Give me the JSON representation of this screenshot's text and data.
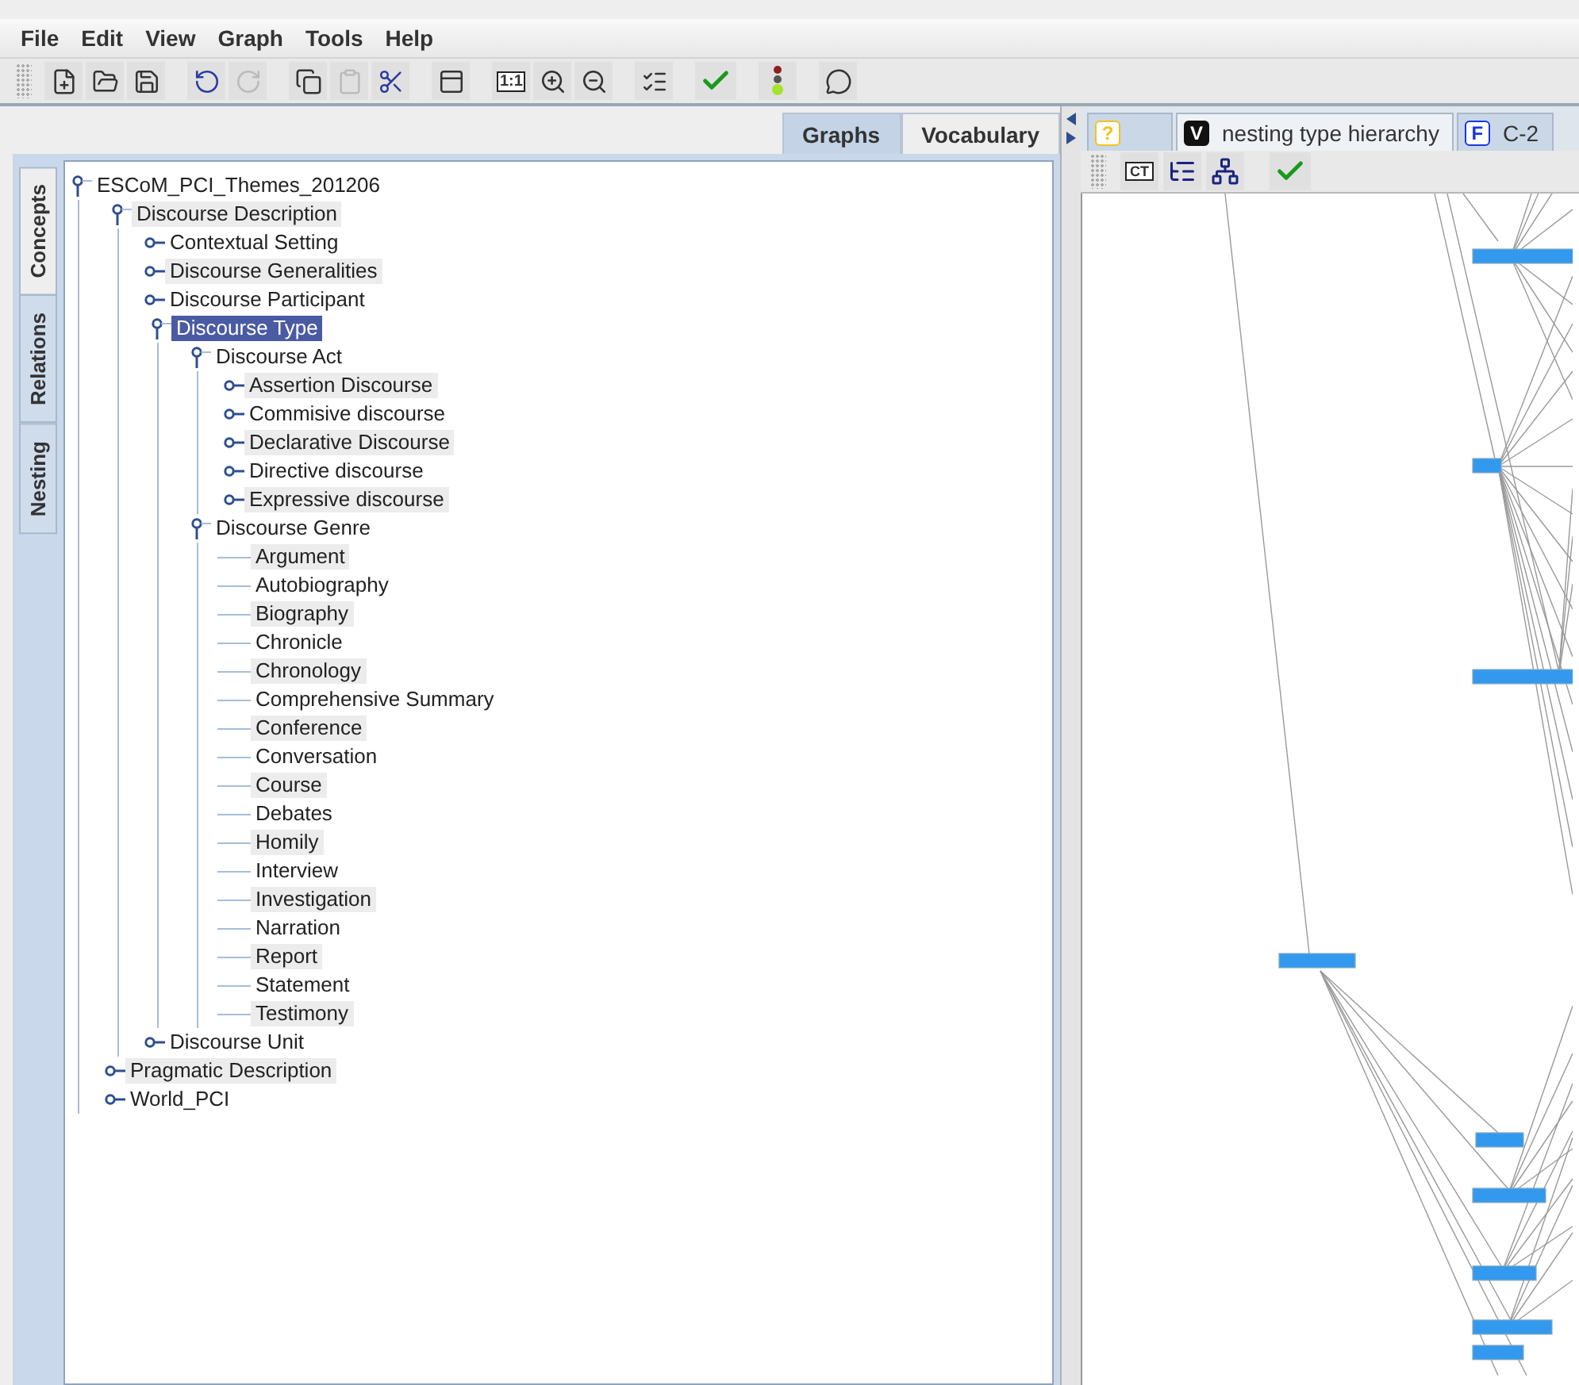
{
  "menu": [
    "File",
    "Edit",
    "View",
    "Graph",
    "Tools",
    "Help"
  ],
  "toolbar": [
    {
      "kind": "new",
      "disabled": false
    },
    {
      "kind": "open",
      "disabled": false
    },
    {
      "kind": "save",
      "disabled": false
    },
    {
      "kind": "sep"
    },
    {
      "kind": "undo",
      "disabled": false
    },
    {
      "kind": "redo",
      "disabled": true
    },
    {
      "kind": "sep"
    },
    {
      "kind": "copy",
      "disabled": false
    },
    {
      "kind": "paste",
      "disabled": true
    },
    {
      "kind": "cut",
      "disabled": false
    },
    {
      "kind": "sep"
    },
    {
      "kind": "layout",
      "disabled": false
    },
    {
      "kind": "sep"
    },
    {
      "kind": "actual",
      "label": "1:1",
      "disabled": false
    },
    {
      "kind": "zoomin",
      "disabled": false
    },
    {
      "kind": "zoomout",
      "disabled": false
    },
    {
      "kind": "sep"
    },
    {
      "kind": "checklist",
      "disabled": false
    },
    {
      "kind": "sep"
    },
    {
      "kind": "check",
      "disabled": false
    },
    {
      "kind": "sep"
    },
    {
      "kind": "light",
      "disabled": false
    },
    {
      "kind": "sep"
    },
    {
      "kind": "comment",
      "disabled": false
    }
  ],
  "top_tabs": [
    {
      "label": "Graphs",
      "selected": false
    },
    {
      "label": "Vocabulary",
      "selected": true
    }
  ],
  "side_tabs": [
    {
      "label": "Concepts",
      "selected": true
    },
    {
      "label": "Relations",
      "selected": false
    },
    {
      "label": "Nesting",
      "selected": false
    }
  ],
  "tree": [
    {
      "label": "ESCoM_PCI_Themes_201206",
      "kind": "branch",
      "expanded": true,
      "highlighted": false,
      "selected": false,
      "children": [
        {
          "label": "Discourse Description",
          "kind": "branch",
          "expanded": true,
          "highlighted": true,
          "selected": false,
          "children": [
            {
              "label": "Contextual Setting",
              "kind": "branch",
              "expanded": false,
              "highlighted": false,
              "selected": false
            },
            {
              "label": "Discourse Generalities",
              "kind": "branch",
              "expanded": false,
              "highlighted": true,
              "selected": false
            },
            {
              "label": "Discourse Participant",
              "kind": "branch",
              "expanded": false,
              "highlighted": false,
              "selected": false
            },
            {
              "label": "Discourse Type",
              "kind": "branch",
              "expanded": true,
              "highlighted": false,
              "selected": true,
              "children": [
                {
                  "label": "Discourse Act",
                  "kind": "branch",
                  "expanded": true,
                  "highlighted": false,
                  "selected": false,
                  "children": [
                    {
                      "label": "Assertion Discourse",
                      "kind": "branch",
                      "expanded": false,
                      "highlighted": true,
                      "selected": false
                    },
                    {
                      "label": "Commisive discourse",
                      "kind": "branch",
                      "expanded": false,
                      "highlighted": false,
                      "selected": false
                    },
                    {
                      "label": "Declarative Discourse",
                      "kind": "branch",
                      "expanded": false,
                      "highlighted": true,
                      "selected": false
                    },
                    {
                      "label": "Directive discourse",
                      "kind": "branch",
                      "expanded": false,
                      "highlighted": false,
                      "selected": false
                    },
                    {
                      "label": "Expressive discourse",
                      "kind": "branch",
                      "expanded": false,
                      "highlighted": true,
                      "selected": false
                    }
                  ]
                },
                {
                  "label": "Discourse Genre",
                  "kind": "branch",
                  "expanded": true,
                  "highlighted": false,
                  "selected": false,
                  "children": [
                    {
                      "label": "Argument",
                      "kind": "leaf",
                      "highlighted": true,
                      "selected": false
                    },
                    {
                      "label": "Autobiography",
                      "kind": "leaf",
                      "highlighted": false,
                      "selected": false
                    },
                    {
                      "label": "Biography",
                      "kind": "leaf",
                      "highlighted": true,
                      "selected": false
                    },
                    {
                      "label": "Chronicle",
                      "kind": "leaf",
                      "highlighted": false,
                      "selected": false
                    },
                    {
                      "label": "Chronology",
                      "kind": "leaf",
                      "highlighted": true,
                      "selected": false
                    },
                    {
                      "label": "Comprehensive Summary",
                      "kind": "leaf",
                      "highlighted": false,
                      "selected": false
                    },
                    {
                      "label": "Conference",
                      "kind": "leaf",
                      "highlighted": true,
                      "selected": false
                    },
                    {
                      "label": "Conversation",
                      "kind": "leaf",
                      "highlighted": false,
                      "selected": false
                    },
                    {
                      "label": "Course",
                      "kind": "leaf",
                      "highlighted": true,
                      "selected": false
                    },
                    {
                      "label": "Debates",
                      "kind": "leaf",
                      "highlighted": false,
                      "selected": false
                    },
                    {
                      "label": "Homily",
                      "kind": "leaf",
                      "highlighted": true,
                      "selected": false
                    },
                    {
                      "label": "Interview",
                      "kind": "leaf",
                      "highlighted": false,
                      "selected": false
                    },
                    {
                      "label": "Investigation",
                      "kind": "leaf",
                      "highlighted": true,
                      "selected": false
                    },
                    {
                      "label": "Narration",
                      "kind": "leaf",
                      "highlighted": false,
                      "selected": false
                    },
                    {
                      "label": "Report",
                      "kind": "leaf",
                      "highlighted": true,
                      "selected": false
                    },
                    {
                      "label": "Statement",
                      "kind": "leaf",
                      "highlighted": false,
                      "selected": false
                    },
                    {
                      "label": "Testimony",
                      "kind": "leaf",
                      "highlighted": true,
                      "selected": false
                    }
                  ]
                }
              ]
            },
            {
              "label": "Discourse Unit",
              "kind": "branch",
              "expanded": false,
              "highlighted": false,
              "selected": false
            }
          ]
        },
        {
          "label": "Pragmatic Description",
          "kind": "branch",
          "expanded": false,
          "highlighted": true,
          "selected": false
        },
        {
          "label": "World_PCI",
          "kind": "branch",
          "expanded": false,
          "highlighted": false,
          "selected": false
        }
      ]
    }
  ],
  "graph_tabs": [
    {
      "badge": "?",
      "color": "#f0c419",
      "selected": false
    },
    {
      "badge": "V",
      "color": "#111111",
      "label": "nesting type hierarchy",
      "selected": true
    },
    {
      "badge": "F",
      "color": "#1a37e0",
      "label": "C-2",
      "selected": false
    }
  ],
  "graph_toolbar": [
    {
      "kind": "ct",
      "label": "CT"
    },
    {
      "kind": "tree"
    },
    {
      "kind": "hierarchy"
    },
    {
      "kind": "sep"
    },
    {
      "kind": "check"
    }
  ]
}
